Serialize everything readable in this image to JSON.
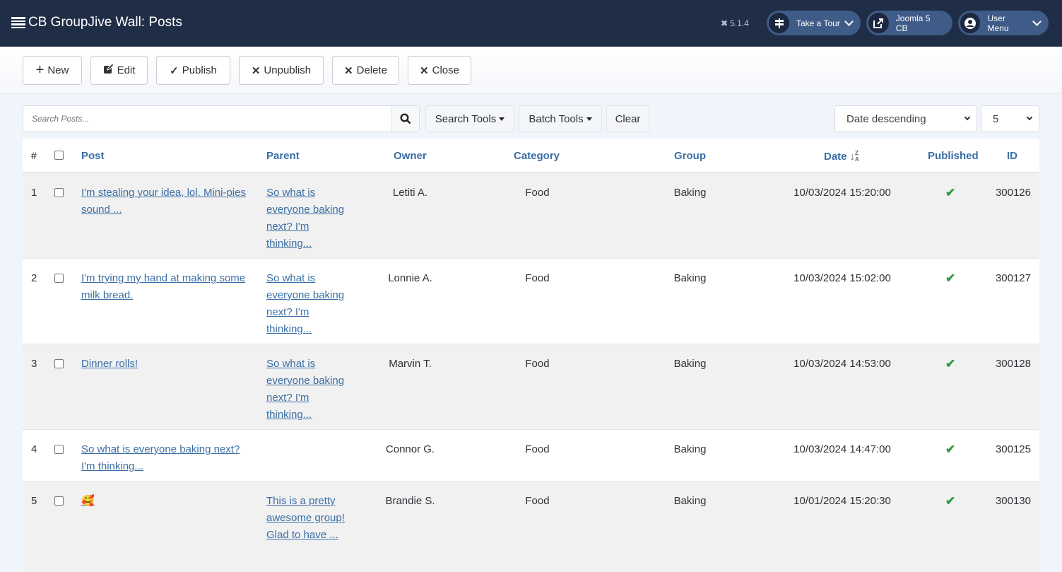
{
  "header": {
    "title": "CB GroupJive Wall: Posts",
    "version": "5.1.4",
    "tour_label": "Take a Tour",
    "site_label": "Joomla 5 CB",
    "user_menu_label": "User Menu"
  },
  "toolbar": {
    "new_label": "New",
    "edit_label": "Edit",
    "publish_label": "Publish",
    "unpublish_label": "Unpublish",
    "delete_label": "Delete",
    "close_label": "Close"
  },
  "filters": {
    "search_placeholder": "Search Posts...",
    "search_tools_label": "Search Tools",
    "batch_tools_label": "Batch Tools",
    "clear_label": "Clear",
    "ordering_value": "Date descending",
    "limit_value": "5"
  },
  "table": {
    "columns": {
      "num": "#",
      "post": "Post",
      "parent": "Parent",
      "owner": "Owner",
      "category": "Category",
      "group": "Group",
      "date": "Date",
      "published": "Published",
      "id": "ID"
    },
    "rows": [
      {
        "num": "1",
        "post": "I'm stealing your idea, lol. Mini-pies sound ...",
        "parent": "So what is everyone baking next? I'm thinking...",
        "owner": "Letiti A.",
        "category": "Food",
        "group": "Baking",
        "date": "10/03/2024 15:20:00",
        "published": true,
        "id": "300126"
      },
      {
        "num": "2",
        "post": "I'm trying my hand at making some milk bread.",
        "parent": "So what is everyone baking next? I'm thinking...",
        "owner": "Lonnie A.",
        "category": "Food",
        "group": "Baking",
        "date": "10/03/2024 15:02:00",
        "published": true,
        "id": "300127"
      },
      {
        "num": "3",
        "post": "Dinner rolls!",
        "parent": "So what is everyone baking next? I'm thinking...",
        "owner": "Marvin T.",
        "category": "Food",
        "group": "Baking",
        "date": "10/03/2024 14:53:00",
        "published": true,
        "id": "300128"
      },
      {
        "num": "4",
        "post": "So what is everyone baking next? I'm thinking...",
        "parent": "",
        "owner": "Connor G.",
        "category": "Food",
        "group": "Baking",
        "date": "10/03/2024 14:47:00",
        "published": true,
        "id": "300125"
      },
      {
        "num": "5",
        "post": "🥰",
        "parent": "This is a pretty awesome group! Glad to have ...",
        "owner": "Brandie S.",
        "category": "Food",
        "group": "Baking",
        "date": "10/01/2024 15:20:30",
        "published": true,
        "id": "300130"
      }
    ]
  },
  "colors": {
    "header_bg": "#1f2d47",
    "pill_bg": "#3f5b87",
    "link": "#3a6ea5",
    "published_check": "#2e9b45"
  }
}
